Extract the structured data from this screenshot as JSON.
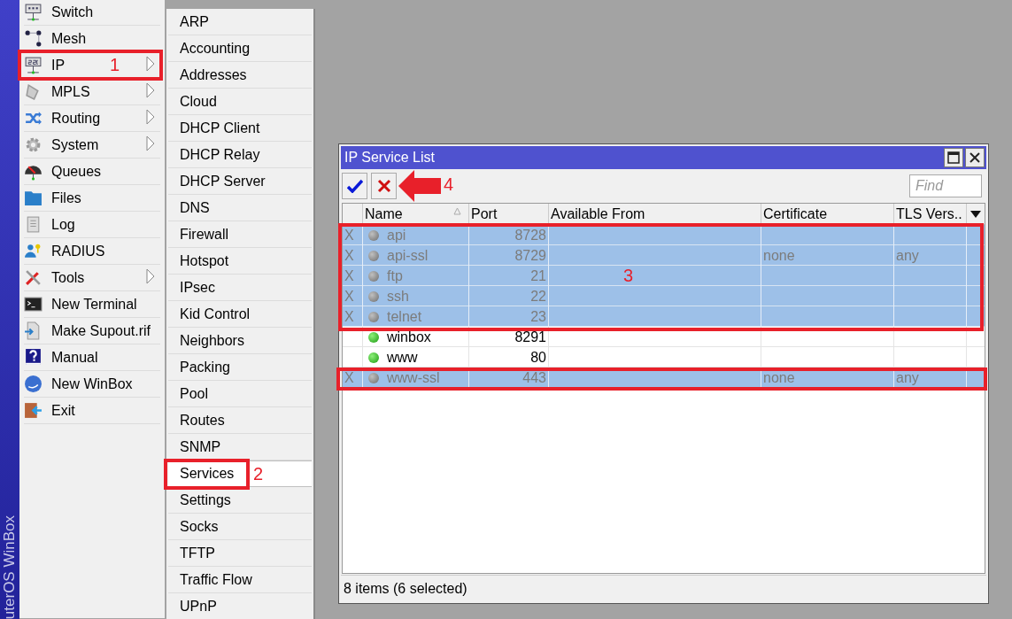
{
  "sidebar_label": "uterOS WinBox",
  "main_menu": [
    {
      "label": "Switch",
      "has_submenu": false
    },
    {
      "label": "Mesh",
      "has_submenu": false
    },
    {
      "label": "IP",
      "has_submenu": true
    },
    {
      "label": "MPLS",
      "has_submenu": true
    },
    {
      "label": "Routing",
      "has_submenu": true
    },
    {
      "label": "System",
      "has_submenu": true
    },
    {
      "label": "Queues",
      "has_submenu": false
    },
    {
      "label": "Files",
      "has_submenu": false
    },
    {
      "label": "Log",
      "has_submenu": false
    },
    {
      "label": "RADIUS",
      "has_submenu": false
    },
    {
      "label": "Tools",
      "has_submenu": true
    },
    {
      "label": "New Terminal",
      "has_submenu": false
    },
    {
      "label": "Make Supout.rif",
      "has_submenu": false
    },
    {
      "label": "Manual",
      "has_submenu": false
    },
    {
      "label": "New WinBox",
      "has_submenu": false
    },
    {
      "label": "Exit",
      "has_submenu": false
    }
  ],
  "submenu": [
    {
      "label": "ARP",
      "selected": false
    },
    {
      "label": "Accounting",
      "selected": false
    },
    {
      "label": "Addresses",
      "selected": false
    },
    {
      "label": "Cloud",
      "selected": false
    },
    {
      "label": "DHCP Client",
      "selected": false
    },
    {
      "label": "DHCP Relay",
      "selected": false
    },
    {
      "label": "DHCP Server",
      "selected": false
    },
    {
      "label": "DNS",
      "selected": false
    },
    {
      "label": "Firewall",
      "selected": false
    },
    {
      "label": "Hotspot",
      "selected": false
    },
    {
      "label": "IPsec",
      "selected": false
    },
    {
      "label": "Kid Control",
      "selected": false
    },
    {
      "label": "Neighbors",
      "selected": false
    },
    {
      "label": "Packing",
      "selected": false
    },
    {
      "label": "Pool",
      "selected": false
    },
    {
      "label": "Routes",
      "selected": false
    },
    {
      "label": "SNMP",
      "selected": false
    },
    {
      "label": "Services",
      "selected": true
    },
    {
      "label": "Settings",
      "selected": false
    },
    {
      "label": "Socks",
      "selected": false
    },
    {
      "label": "TFTP",
      "selected": false
    },
    {
      "label": "Traffic Flow",
      "selected": false
    },
    {
      "label": "UPnP",
      "selected": false
    }
  ],
  "window": {
    "title": "IP Service List",
    "find_placeholder": "Find",
    "columns": [
      "Name",
      "Port",
      "Available From",
      "Certificate",
      "TLS Vers.."
    ],
    "rows": [
      {
        "flag": "X",
        "name": "api",
        "port": "8728",
        "enabled": false,
        "selected": true
      },
      {
        "flag": "X",
        "name": "api-ssl",
        "port": "8729",
        "certificate": "none",
        "tls_version": "any",
        "enabled": false,
        "selected": true
      },
      {
        "flag": "X",
        "name": "ftp",
        "port": "21",
        "enabled": false,
        "selected": true
      },
      {
        "flag": "X",
        "name": "ssh",
        "port": "22",
        "enabled": false,
        "selected": true
      },
      {
        "flag": "X",
        "name": "telnet",
        "port": "23",
        "enabled": false,
        "selected": true
      },
      {
        "name": "winbox",
        "port": "8291",
        "enabled": true,
        "selected": false
      },
      {
        "name": "www",
        "port": "80",
        "enabled": true,
        "selected": false
      },
      {
        "flag": "X",
        "name": "www-ssl",
        "port": "443",
        "certificate": "none",
        "tls_version": "any",
        "enabled": false,
        "selected": true
      }
    ],
    "status": "8 items (6 selected)"
  },
  "annotations": [
    {
      "label": "1"
    },
    {
      "label": "2"
    },
    {
      "label": "3"
    },
    {
      "label": "4"
    }
  ]
}
